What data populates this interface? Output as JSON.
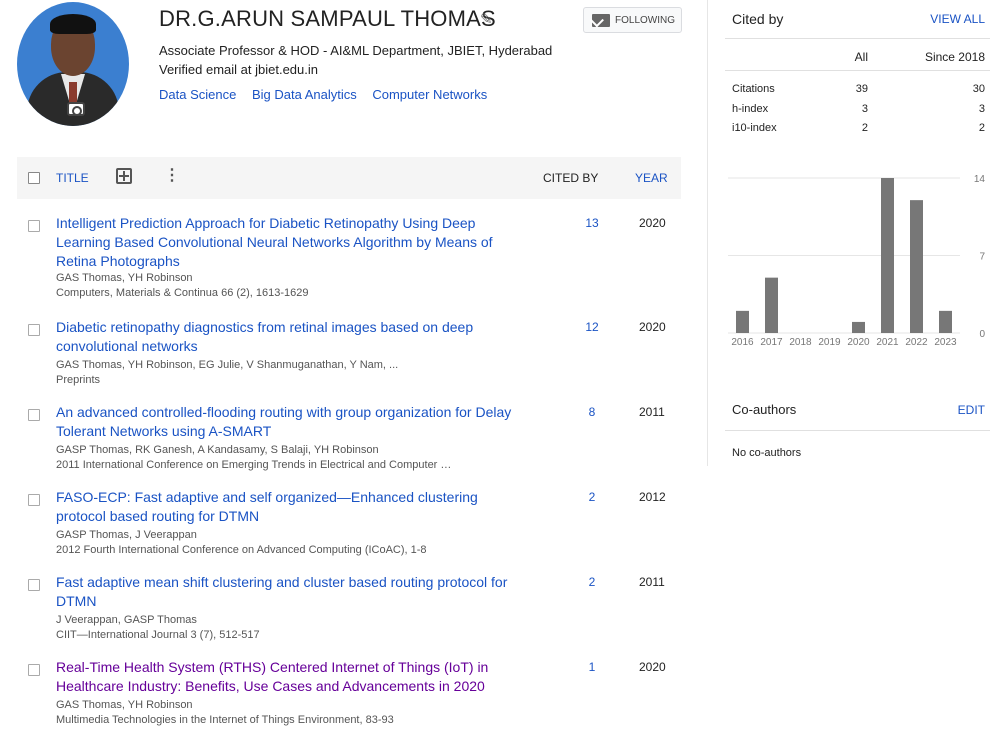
{
  "profile": {
    "name": "DR.G.ARUN SAMPAUL THOMAS",
    "affiliation": "Associate Professor & HOD - AI&ML Department, JBIET, Hyderabad",
    "email": "Verified email at jbiet.edu.in",
    "interests": [
      "Data Science",
      "Big Data Analytics",
      "Computer Networks"
    ],
    "follow_label": "FOLLOWING"
  },
  "table": {
    "title_header": "TITLE",
    "cited_header": "CITED BY",
    "year_header": "YEAR",
    "rows": [
      {
        "title": "Intelligent Prediction Approach for Diabetic Retinopathy Using Deep Learning Based Convolutional Neural Networks Algorithm by Means of Retina Photographs",
        "authors": "GAS Thomas, YH Robinson",
        "venue": "Computers, Materials & Continua 66 (2), 1613-1629",
        "cited": "13",
        "year": "2020"
      },
      {
        "title": "Diabetic retinopathy diagnostics from retinal images based on deep convolutional networks",
        "authors": "GAS Thomas, YH Robinson, EG Julie, V Shanmuganathan, Y Nam, ...",
        "venue": "Preprints",
        "cited": "12",
        "year": "2020"
      },
      {
        "title": "An advanced controlled-flooding routing with group organization for Delay Tolerant Networks using A-SMART",
        "authors": "GASP Thomas, RK Ganesh, A Kandasamy, S Balaji, YH Robinson",
        "venue": "2011 International Conference on Emerging Trends in Electrical and Computer …",
        "cited": "8",
        "year": "2011"
      },
      {
        "title": "FASO-ECP: Fast adaptive and self organized—Enhanced clustering protocol based routing for DTMN",
        "authors": "GASP Thomas, J Veerappan",
        "venue": "2012 Fourth International Conference on Advanced Computing (ICoAC), 1-8",
        "cited": "2",
        "year": "2012"
      },
      {
        "title": "Fast adaptive mean shift clustering and cluster based routing protocol for DTMN",
        "authors": "J Veerappan, GASP Thomas",
        "venue": "CIIT—International Journal 3 (7), 512-517",
        "cited": "2",
        "year": "2011"
      },
      {
        "title": "Real-Time Health System (RTHS) Centered Internet of Things (IoT) in Healthcare Industry: Benefits, Use Cases and Advancements in 2020",
        "authors": "GAS Thomas, YH Robinson",
        "venue": "Multimedia Technologies in the Internet of Things Environment, 83-93",
        "cited": "1",
        "year": "2020"
      }
    ]
  },
  "cited_by": {
    "title": "Cited by",
    "view_all": "VIEW ALL",
    "col_all": "All",
    "col_since": "Since 2018",
    "stats": [
      {
        "label": "Citations",
        "all": "39",
        "since": "30"
      },
      {
        "label": "h-index",
        "all": "3",
        "since": "3"
      },
      {
        "label": "i10-index",
        "all": "2",
        "since": "2"
      }
    ]
  },
  "chart_data": {
    "type": "bar",
    "categories": [
      "2016",
      "2017",
      "2018",
      "2019",
      "2020",
      "2021",
      "2022",
      "2023"
    ],
    "values": [
      2,
      5,
      0,
      0,
      1,
      14,
      12,
      2
    ],
    "yticks": [
      "14",
      "7",
      "0"
    ],
    "ylim": [
      0,
      14
    ],
    "bar_color": "#777777"
  },
  "coauthors": {
    "title": "Co-authors",
    "edit": "EDIT",
    "empty": "No co-authors"
  },
  "colors": {
    "link": "#1a53c4",
    "visited": "#660099",
    "header_bg": "#f5f5f5"
  }
}
